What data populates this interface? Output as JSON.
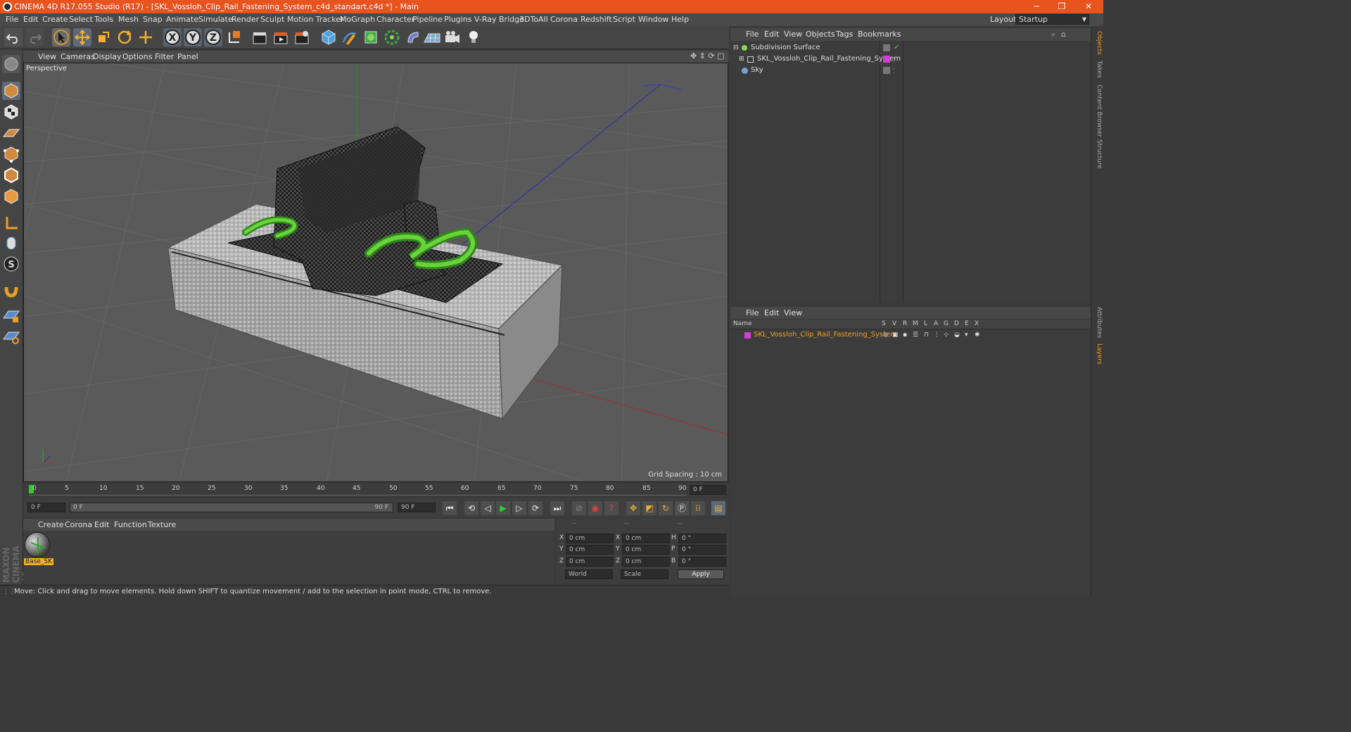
{
  "window": {
    "title": "CINEMA 4D R17.055 Studio (R17) - [SKL_Vossloh_Clip_Rail_Fastening_System_c4d_standart.c4d *] - Main",
    "minimize": "─",
    "maximize": "❐",
    "close": "✕"
  },
  "menubar": {
    "items": [
      "File",
      "Edit",
      "Create",
      "Select",
      "Tools",
      "Mesh",
      "Snap",
      "Animate",
      "Simulate",
      "Render",
      "Sculpt",
      "Motion Tracker",
      "MoGraph",
      "Character",
      "Pipeline",
      "Plugins",
      "V-Ray Bridge",
      "3DToAll",
      "Corona",
      "Redshift",
      "Script",
      "Window",
      "Help"
    ],
    "layout_label": "Layout:",
    "layout_value": "Startup"
  },
  "viewport": {
    "menu": [
      "View",
      "Cameras",
      "Display",
      "Options",
      "Filter",
      "Panel"
    ],
    "label": "Perspective",
    "grid_spacing": "Grid Spacing : 10 cm"
  },
  "timeline": {
    "ticks": [
      "0",
      "5",
      "10",
      "15",
      "20",
      "25",
      "30",
      "35",
      "40",
      "45",
      "50",
      "55",
      "60",
      "65",
      "70",
      "75",
      "80",
      "85",
      "90"
    ],
    "frame_right": "0 F"
  },
  "transport": {
    "start": "0 F",
    "range_start": "0 F",
    "range_end": "90 F",
    "end": "90 F"
  },
  "material": {
    "menu": [
      "Create",
      "Corona",
      "Edit",
      "Function",
      "Texture"
    ],
    "name": "Base_SK"
  },
  "coords": {
    "header": [
      "--",
      "--",
      "--"
    ],
    "rows": [
      {
        "a": "X",
        "av": "0 cm",
        "b": "X",
        "bv": "0 cm",
        "c": "H",
        "cv": "0 °"
      },
      {
        "a": "Y",
        "av": "0 cm",
        "b": "Y",
        "bv": "0 cm",
        "c": "P",
        "cv": "0 °"
      },
      {
        "a": "Z",
        "av": "0 cm",
        "b": "Z",
        "bv": "0 cm",
        "c": "B",
        "cv": "0 °"
      }
    ],
    "mode1": "World",
    "mode2": "Scale",
    "apply": "Apply"
  },
  "object_manager": {
    "menu": [
      "File",
      "Edit",
      "View",
      "Objects",
      "Tags",
      "Bookmarks"
    ],
    "objects": [
      {
        "name": "Subdivision Surface",
        "color": "#8ad65a"
      },
      {
        "name": "SKL_Vossloh_Clip_Rail_Fastening_System",
        "color": "#d040d0"
      },
      {
        "name": "Sky",
        "color": "#7aa0d0"
      }
    ]
  },
  "layer_manager": {
    "menu": [
      "File",
      "Edit",
      "View"
    ],
    "columns": [
      "Name",
      "S",
      "V",
      "R",
      "M",
      "L",
      "A",
      "G",
      "D",
      "E",
      "X"
    ],
    "layers": [
      {
        "name": "SKL_Vossloh_Clip_Rail_Fastening_System",
        "color": "#d040d0"
      }
    ]
  },
  "side_tabs": [
    "Objects",
    "Takes",
    "Content Browser",
    "Structure",
    "Attributes",
    "Layers"
  ],
  "maxon_brand": "MAXON CINEMA 4D",
  "status": "Move: Click and drag to move elements. Hold down SHIFT to quantize movement / add to the selection in point mode, CTRL to remove."
}
